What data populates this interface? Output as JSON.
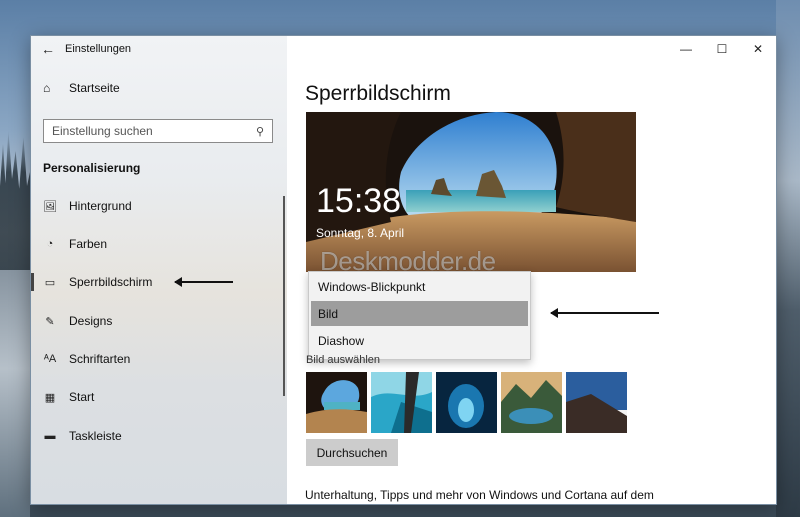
{
  "window": {
    "title": "Einstellungen",
    "controls": {
      "minimize": "—",
      "maximize": "☐",
      "close": "✕"
    }
  },
  "sidebar": {
    "home_label": "Startseite",
    "search_placeholder": "Einstellung suchen",
    "section_title": "Personalisierung",
    "items": [
      {
        "label": "Hintergrund",
        "icon": "image-icon"
      },
      {
        "label": "Farben",
        "icon": "palette-icon"
      },
      {
        "label": "Sperrbildschirm",
        "icon": "lockscreen-icon",
        "active": true
      },
      {
        "label": "Designs",
        "icon": "designs-icon"
      },
      {
        "label": "Schriftarten",
        "icon": "fonts-icon"
      },
      {
        "label": "Start",
        "icon": "start-icon"
      },
      {
        "label": "Taskleiste",
        "icon": "taskbar-icon"
      }
    ]
  },
  "main": {
    "title": "Sperrbildschirm",
    "preview": {
      "time": "15:38",
      "date": "Sonntag, 8. April",
      "watermark": "Deskmodder.de"
    },
    "dropdown": {
      "options": [
        "Windows-Blickpunkt",
        "Bild",
        "Diashow"
      ],
      "selected": "Bild"
    },
    "choose_image_label": "Bild auswählen",
    "browse_button": "Durchsuchen",
    "footer_text": "Unterhaltung, Tipps und mehr von Windows und Cortana auf dem"
  },
  "colors": {
    "selected_option": "#9d9d9d",
    "button_bg": "#cccccc",
    "accent_indicator": "#444444"
  }
}
